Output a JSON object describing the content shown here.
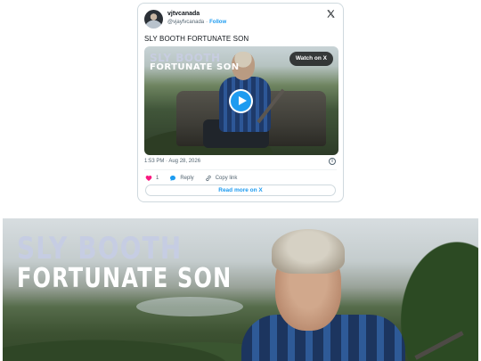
{
  "tweet": {
    "display_name": "vjtvcanada",
    "handle": "@vjayfvcanada",
    "separator": "·",
    "follow_label": "Follow",
    "text": "SLY BOOTH FORTUNATE SON",
    "media": {
      "title_line1": "SLY BOOTH",
      "title_line2": "FORTUNATE SON",
      "watch_label": "Watch on X"
    },
    "timestamp": "1:53 PM · Aug 28, 2026",
    "info_icon_glyph": "i",
    "likes_count": "1",
    "reply_label": "Reply",
    "copy_link_label": "Copy link",
    "read_more_label": "Read more on X"
  },
  "banner": {
    "title_line1": "SLY BOOTH",
    "title_line2": "FORTUNATE SON"
  },
  "colors": {
    "accent": "#1d9bf0",
    "like": "#f91880",
    "muted": "#536471",
    "border": "#cfd9de"
  },
  "icons": [
    "x-logo-icon",
    "play-icon",
    "info-icon",
    "heart-icon",
    "reply-icon",
    "link-icon"
  ]
}
